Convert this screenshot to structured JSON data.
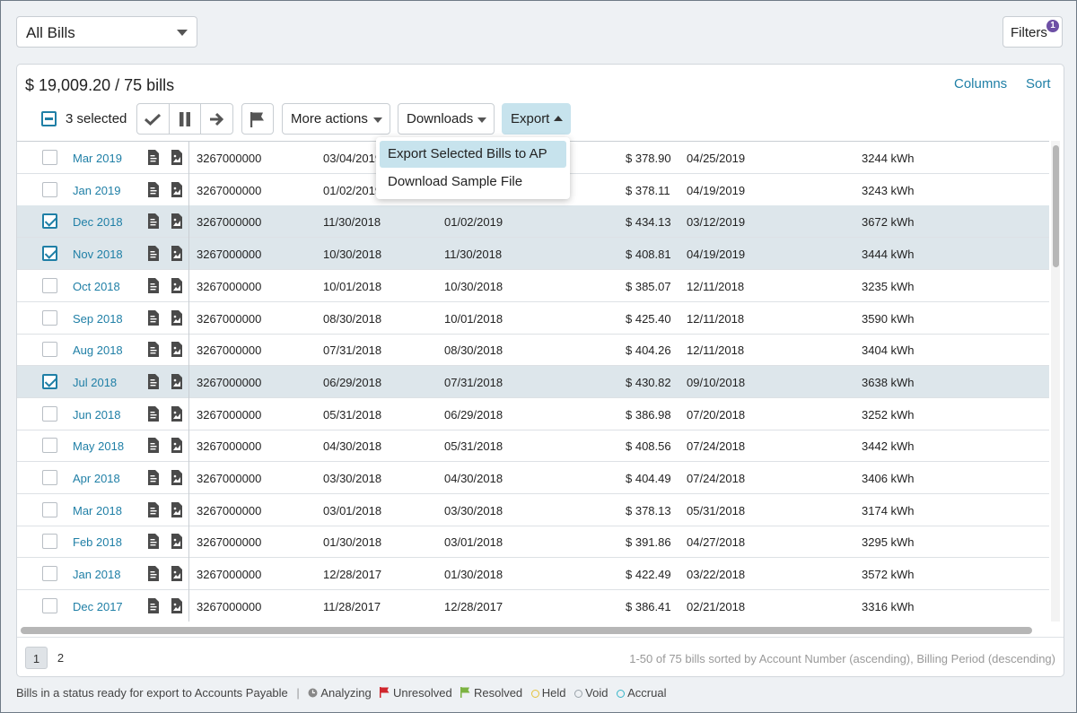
{
  "top": {
    "bills_select": "All Bills",
    "filters_label": "Filters",
    "filters_count": "1"
  },
  "summary": {
    "total": "$ 19,009.20 / 75 bills",
    "columns_link": "Columns",
    "sort_link": "Sort"
  },
  "toolbar": {
    "selected_label": "3 selected",
    "more_actions": "More actions",
    "downloads": "Downloads",
    "export": "Export"
  },
  "export_menu": {
    "items": [
      "Export Selected Bills to AP",
      "Download Sample File"
    ]
  },
  "rows": [
    {
      "period": "Mar 2019",
      "account": "3267000000",
      "start": "03/04/2019",
      "end": "",
      "amount": "$ 378.90",
      "due": "04/25/2019",
      "usage": "3244 kWh",
      "selected": false
    },
    {
      "period": "Jan 2019",
      "account": "3267000000",
      "start": "01/02/2019",
      "end": "",
      "amount": "$ 378.11",
      "due": "04/19/2019",
      "usage": "3243 kWh",
      "selected": false
    },
    {
      "period": "Dec 2018",
      "account": "3267000000",
      "start": "11/30/2018",
      "end": "01/02/2019",
      "amount": "$ 434.13",
      "due": "03/12/2019",
      "usage": "3672 kWh",
      "selected": true
    },
    {
      "period": "Nov 2018",
      "account": "3267000000",
      "start": "10/30/2018",
      "end": "11/30/2018",
      "amount": "$ 408.81",
      "due": "04/19/2019",
      "usage": "3444 kWh",
      "selected": true
    },
    {
      "period": "Oct 2018",
      "account": "3267000000",
      "start": "10/01/2018",
      "end": "10/30/2018",
      "amount": "$ 385.07",
      "due": "12/11/2018",
      "usage": "3235 kWh",
      "selected": false
    },
    {
      "period": "Sep 2018",
      "account": "3267000000",
      "start": "08/30/2018",
      "end": "10/01/2018",
      "amount": "$ 425.40",
      "due": "12/11/2018",
      "usage": "3590 kWh",
      "selected": false
    },
    {
      "period": "Aug 2018",
      "account": "3267000000",
      "start": "07/31/2018",
      "end": "08/30/2018",
      "amount": "$ 404.26",
      "due": "12/11/2018",
      "usage": "3404 kWh",
      "selected": false
    },
    {
      "period": "Jul 2018",
      "account": "3267000000",
      "start": "06/29/2018",
      "end": "07/31/2018",
      "amount": "$ 430.82",
      "due": "09/10/2018",
      "usage": "3638 kWh",
      "selected": true
    },
    {
      "period": "Jun 2018",
      "account": "3267000000",
      "start": "05/31/2018",
      "end": "06/29/2018",
      "amount": "$ 386.98",
      "due": "07/20/2018",
      "usage": "3252 kWh",
      "selected": false
    },
    {
      "period": "May 2018",
      "account": "3267000000",
      "start": "04/30/2018",
      "end": "05/31/2018",
      "amount": "$ 408.56",
      "due": "07/24/2018",
      "usage": "3442 kWh",
      "selected": false
    },
    {
      "period": "Apr 2018",
      "account": "3267000000",
      "start": "03/30/2018",
      "end": "04/30/2018",
      "amount": "$ 404.49",
      "due": "07/24/2018",
      "usage": "3406 kWh",
      "selected": false
    },
    {
      "period": "Mar 2018",
      "account": "3267000000",
      "start": "03/01/2018",
      "end": "03/30/2018",
      "amount": "$ 378.13",
      "due": "05/31/2018",
      "usage": "3174 kWh",
      "selected": false
    },
    {
      "period": "Feb 2018",
      "account": "3267000000",
      "start": "01/30/2018",
      "end": "03/01/2018",
      "amount": "$ 391.86",
      "due": "04/27/2018",
      "usage": "3295 kWh",
      "selected": false
    },
    {
      "period": "Jan 2018",
      "account": "3267000000",
      "start": "12/28/2017",
      "end": "01/30/2018",
      "amount": "$ 422.49",
      "due": "03/22/2018",
      "usage": "3572 kWh",
      "selected": false
    },
    {
      "period": "Dec 2017",
      "account": "3267000000",
      "start": "11/28/2017",
      "end": "12/28/2017",
      "amount": "$ 386.41",
      "due": "02/21/2018",
      "usage": "3316 kWh",
      "selected": false
    }
  ],
  "pager": {
    "pages": [
      "1",
      "2"
    ],
    "info": "1-50 of 75 bills sorted by Account Number (ascending), Billing Period (descending)"
  },
  "legend": {
    "intro": "Bills in a status ready for export to Accounts Payable",
    "separator": "|",
    "items": [
      {
        "label": "Analyzing",
        "color": "#888888",
        "icon": "clock-icon"
      },
      {
        "label": "Unresolved",
        "color": "#d0262d",
        "icon": "red-flag-icon"
      },
      {
        "label": "Resolved",
        "color": "#7cb342",
        "icon": "green-flag-icon"
      },
      {
        "label": "Held",
        "color": "#e5c23a",
        "icon": "yellow-dot-icon"
      },
      {
        "label": "Void",
        "color": "#9aa3aa",
        "icon": "gray-dot-icon"
      },
      {
        "label": "Accrual",
        "color": "#37b6c9",
        "icon": "teal-dot-icon"
      }
    ]
  }
}
